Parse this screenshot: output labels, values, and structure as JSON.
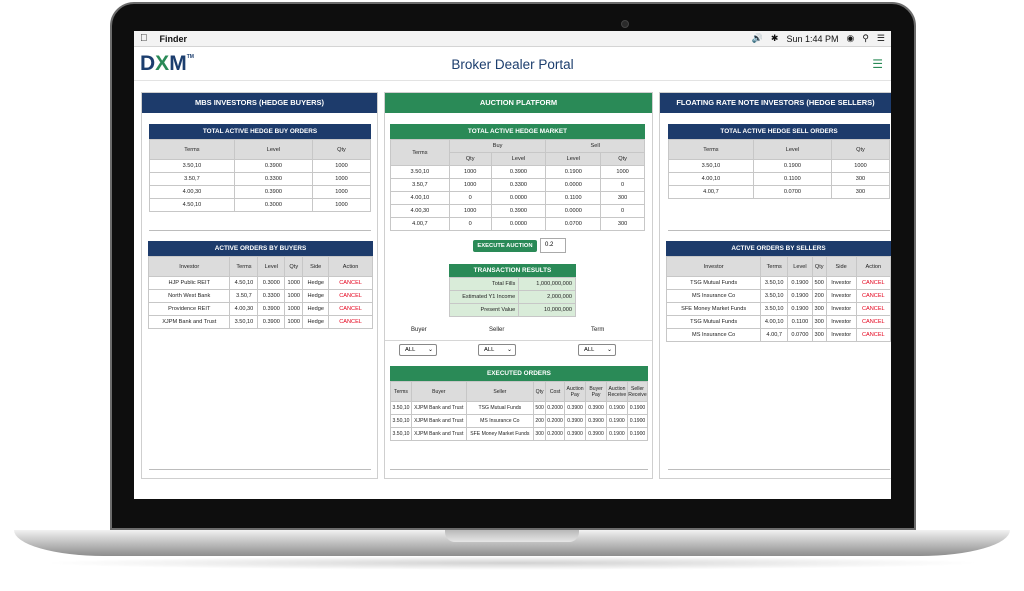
{
  "menubar": {
    "app": "Finder",
    "clock": "Sun 1:44 PM"
  },
  "header": {
    "logo_a": "D",
    "logo_x": "X",
    "logo_b": "M",
    "logo_tm": "TM",
    "title": "Broker Dealer Portal"
  },
  "buyers": {
    "heading": "MBS INVESTORS (HEDGE BUYERS)",
    "orders_title": "TOTAL ACTIVE HEDGE BUY ORDERS",
    "orders_cols": [
      "Terms",
      "Level",
      "Qty"
    ],
    "orders": [
      [
        "3.50,10",
        "0.3900",
        "1000"
      ],
      [
        "3.50,7",
        "0.3300",
        "1000"
      ],
      [
        "4.00,30",
        "0.3900",
        "1000"
      ],
      [
        "4.50,10",
        "0.3000",
        "1000"
      ]
    ],
    "active_title": "ACTIVE ORDERS BY BUYERS",
    "active_cols": [
      "Investor",
      "Terms",
      "Level",
      "Qty",
      "Side",
      "Action"
    ],
    "active": [
      [
        "HJP Public REIT",
        "4.50,10",
        "0.3000",
        "1000",
        "Hedge",
        "CANCEL"
      ],
      [
        "North West Bank",
        "3.50,7",
        "0.3300",
        "1000",
        "Hedge",
        "CANCEL"
      ],
      [
        "Providence REIT",
        "4.00,30",
        "0.3900",
        "1000",
        "Hedge",
        "CANCEL"
      ],
      [
        "XJPM Bank and Trust",
        "3.50,10",
        "0.3900",
        "1000",
        "Hedge",
        "CANCEL"
      ]
    ]
  },
  "auction": {
    "heading": "AUCTION PLATFORM",
    "market_title": "TOTAL ACTIVE HEDGE MARKET",
    "col_terms": "Terms",
    "col_buy": "Buy",
    "col_sell": "Sell",
    "sub_cols": [
      "Qty",
      "Level",
      "Level",
      "Qty"
    ],
    "market": [
      [
        "3.50,10",
        "1000",
        "0.3900",
        "0.1900",
        "1000"
      ],
      [
        "3.50,7",
        "1000",
        "0.3300",
        "0.0000",
        "0"
      ],
      [
        "4.00,10",
        "0",
        "0.0000",
        "0.1100",
        "300"
      ],
      [
        "4.00,30",
        "1000",
        "0.3900",
        "0.0000",
        "0"
      ],
      [
        "4.00,7",
        "0",
        "0.0000",
        "0.0700",
        "300"
      ]
    ],
    "execute_label": "EXECUTE AUCTION",
    "execute_value": "0.2",
    "results_title": "TRANSACTION RESULTS",
    "results": [
      [
        "Total Fills",
        "1,000,000,000"
      ],
      [
        "Estimated Y1 Income",
        "2,000,000"
      ],
      [
        "Present Value",
        "10,000,000"
      ]
    ],
    "filter_buyer": "Buyer",
    "filter_seller": "Seller",
    "filter_term": "Term",
    "filter_value": "ALL",
    "executed_title": "EXECUTED ORDERS",
    "executed_cols": [
      "Terms",
      "Buyer",
      "Seller",
      "Qty",
      "Cost",
      "Auction Pay",
      "Buyer Pay",
      "Auction Receive",
      "Seller Receive"
    ],
    "executed": [
      [
        "3.50,10",
        "XJPM Bank and Trust",
        "TSG Mutual Funds",
        "500",
        "0.2000",
        "0.3900",
        "0.3900",
        "0.1900",
        "0.1900"
      ],
      [
        "3.50,10",
        "XJPM Bank and Trust",
        "MS Insurance Co",
        "200",
        "0.2000",
        "0.3900",
        "0.3900",
        "0.1900",
        "0.1900"
      ],
      [
        "3.50,10",
        "XJPM Bank and Trust",
        "SFE Money Market Funds",
        "300",
        "0.2000",
        "0.3900",
        "0.3900",
        "0.1900",
        "0.1900"
      ]
    ]
  },
  "sellers": {
    "heading": "FLOATING RATE NOTE INVESTORS (HEDGE SELLERS)",
    "orders_title": "TOTAL ACTIVE HEDGE SELL ORDERS",
    "orders_cols": [
      "Terms",
      "Level",
      "Qty"
    ],
    "orders": [
      [
        "3.50,10",
        "0.1900",
        "1000"
      ],
      [
        "4.00,10",
        "0.1100",
        "300"
      ],
      [
        "4.00,7",
        "0.0700",
        "300"
      ]
    ],
    "active_title": "ACTIVE ORDERS BY SELLERS",
    "active_cols": [
      "Investor",
      "Terms",
      "Level",
      "Qty",
      "Side",
      "Action"
    ],
    "active": [
      [
        "TSG Mutual Funds",
        "3.50,10",
        "0.1900",
        "500",
        "Investor",
        "CANCEL"
      ],
      [
        "MS Insurance Co",
        "3.50,10",
        "0.1900",
        "200",
        "Investor",
        "CANCEL"
      ],
      [
        "SFE Money Market Funds",
        "3.50,10",
        "0.1900",
        "300",
        "Investor",
        "CANCEL"
      ],
      [
        "TSG Mutual Funds",
        "4.00,10",
        "0.1100",
        "300",
        "Investor",
        "CANCEL"
      ],
      [
        "MS Insurance Co",
        "4.00,7",
        "0.0700",
        "300",
        "Investor",
        "CANCEL"
      ]
    ]
  },
  "colors": {
    "navy": "#1d3b6b",
    "green": "#2a8a57",
    "cancel": "#e4001b"
  }
}
